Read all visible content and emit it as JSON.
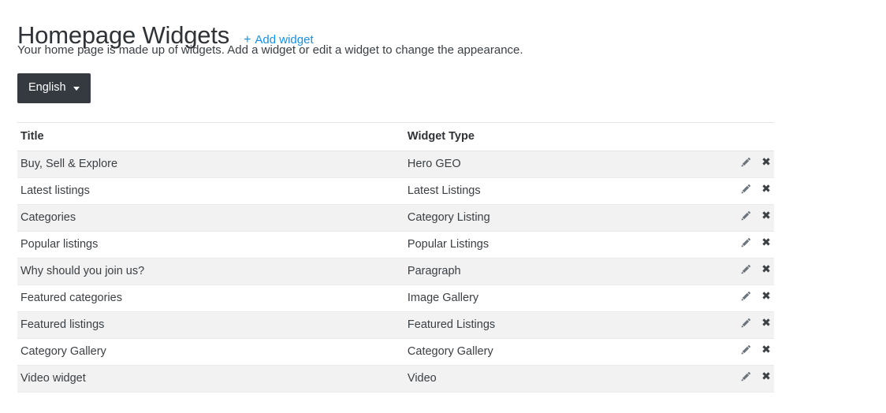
{
  "header": {
    "title": "Homepage Widgets",
    "add_widget_label": "Add widget",
    "add_widget_plus": "+",
    "subtitle": "Your home page is made up of widgets. Add a widget or edit a widget to change the appearance."
  },
  "language_selector": {
    "selected": "English",
    "caret_icon": "chevron-down-icon"
  },
  "table": {
    "columns": [
      "Title",
      "Widget Type",
      ""
    ],
    "rows": [
      {
        "title": "Buy, Sell & Explore",
        "type": "Hero GEO"
      },
      {
        "title": "Latest listings",
        "type": "Latest Listings"
      },
      {
        "title": "Categories",
        "type": "Category Listing"
      },
      {
        "title": "Popular listings",
        "type": "Popular Listings"
      },
      {
        "title": "Why should you join us?",
        "type": "Paragraph"
      },
      {
        "title": "Featured categories",
        "type": "Image Gallery"
      },
      {
        "title": "Featured listings",
        "type": "Featured Listings"
      },
      {
        "title": "Category Gallery",
        "type": "Category Gallery"
      },
      {
        "title": "Video widget",
        "type": "Video"
      }
    ],
    "actions": {
      "edit_icon": "pencil-icon",
      "delete_icon": "close-x-icon",
      "delete_glyph": "✖"
    }
  },
  "colors": {
    "link": "#1a8fe3",
    "button_bg": "#343a40",
    "stripe": "#f2f2f2",
    "text": "#3a3f44",
    "border": "#e3e3e3"
  }
}
